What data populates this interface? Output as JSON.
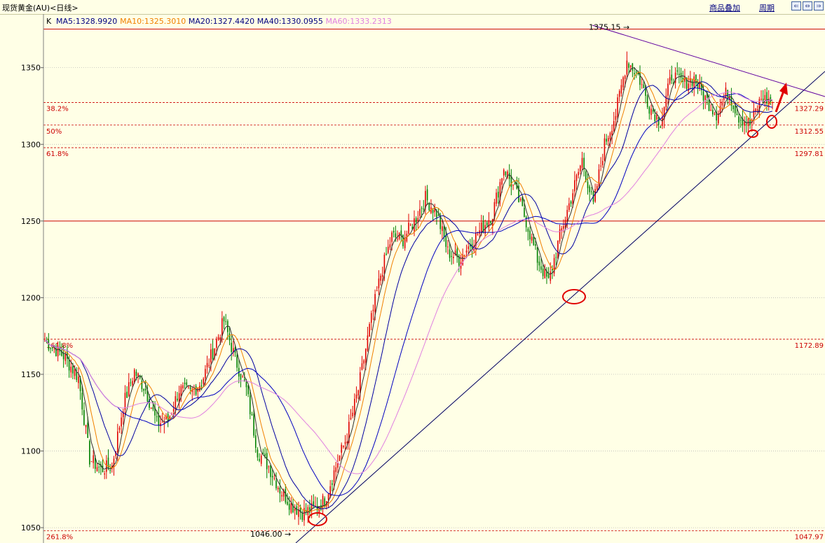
{
  "header": {
    "title": "现货黄金(AU)<日线>",
    "overlay_label": "商品叠加",
    "period_label": "周期",
    "nav_buttons": [
      "⇐",
      "⇔",
      "⇒",
      "▭"
    ]
  },
  "ma_legend": {
    "k": "K",
    "items": [
      {
        "text": "MA5:1328.9920",
        "color": "#000080"
      },
      {
        "text": "MA10:1325.3010",
        "color": "#f08000"
      },
      {
        "text": "MA20:1327.4420",
        "color": "#000080"
      },
      {
        "text": "MA40:1330.0955",
        "color": "#000080"
      },
      {
        "text": "MA60:1333.2313",
        "color": "#e080e0"
      }
    ]
  },
  "chart_data": {
    "type": "candlestick",
    "ylim": [
      1040,
      1385
    ],
    "y_ticks": [
      1050,
      1100,
      1150,
      1200,
      1250,
      1300,
      1350
    ],
    "fib_levels": [
      {
        "label_left": "38.2%",
        "label_right": "1327.29",
        "value": 1327.29
      },
      {
        "label_left": "50%",
        "label_right": "1312.55",
        "value": 1312.55
      },
      {
        "label_left": "61.8%",
        "label_right": "1297.81",
        "value": 1297.81
      },
      {
        "label_left": "161.8%",
        "label_right": "1172.89",
        "value": 1172.89
      },
      {
        "label_left": "261.8%",
        "label_right": "1047.97",
        "value": 1047.97
      }
    ],
    "horizontal_lines": [
      1375.15,
      1250
    ],
    "annotations": [
      {
        "text": "1375.15",
        "value": 1375.15
      },
      {
        "text": "1046.00",
        "value": 1046.0
      }
    ],
    "colors": {
      "up": "#e00000",
      "down": "#008000",
      "ma5": "#303030",
      "ma10": "#f08000",
      "ma20": "#0000a0",
      "ma40": "#0000c0",
      "ma60": "#e080e0",
      "grid": "#b0b0b0",
      "fib": "#cc0000",
      "trend": "#000060",
      "marker": "#e00000"
    },
    "ohlc": []
  }
}
